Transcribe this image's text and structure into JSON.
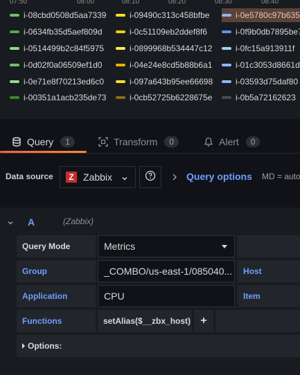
{
  "graph": {
    "time_ticks": [
      "07:50",
      "08:00",
      "08:10",
      "08:20",
      "08:30",
      "08:40"
    ],
    "legend": [
      [
        {
          "label": "i-08cbd0508d5aa7339",
          "color": "#73bf69"
        },
        {
          "label": "i-09490c313c458bfbe",
          "color": "#fade2a"
        },
        {
          "label": "i-0e5780c97b635",
          "color": "#8ab8ff"
        }
      ],
      [
        {
          "label": "i-0634fb35d5aef809d",
          "color": "#56a64b"
        },
        {
          "label": "i-0c51109eb2ddef8f6",
          "color": "#f2cc0c"
        },
        {
          "label": "i-0f9b0db7895be7",
          "color": "#5794f2"
        }
      ],
      [
        {
          "label": "i-0514499b2c84f5975",
          "color": "#96d98d"
        },
        {
          "label": "i-0899968b534447c12",
          "color": "#ffee52"
        },
        {
          "label": "i-0fc15a913911f",
          "color": "#a3d0f0"
        }
      ],
      [
        {
          "label": "i-0d02f0a06509ef1d0",
          "color": "#73bf69"
        },
        {
          "label": "i-04e24e8cd5b88b6a1",
          "color": "#e0b400"
        },
        {
          "label": "i-01c3053d8661d",
          "color": "#8ab8ff"
        }
      ],
      [
        {
          "label": "i-0e71e8f70213ed6c0",
          "color": "#96d98d"
        },
        {
          "label": "i-097a643b95ee66698",
          "color": "#fade2a"
        },
        {
          "label": "i-03593d75daf80",
          "color": "#8ab8ff"
        }
      ],
      [
        {
          "label": "i-00351a1acb235de73",
          "color": "#37872d"
        },
        {
          "label": "i-0cb52725b6228675e",
          "color": "#8a6d1a"
        },
        {
          "label": "i-0b5a72162623",
          "color": "#464c54"
        }
      ]
    ]
  },
  "tabs": [
    {
      "label": "Query",
      "count": "1",
      "icon": "database-icon"
    },
    {
      "label": "Transform",
      "count": "0",
      "icon": "transform-icon"
    },
    {
      "label": "Alert",
      "count": "0",
      "icon": "bell-icon"
    }
  ],
  "datasource_row": {
    "label": "Data source",
    "selected": "Zabbix",
    "logo_letter": "Z",
    "query_options_label": "Query options",
    "query_options_meta": "MD = auto"
  },
  "query": {
    "ref_id": "A",
    "datasource": "(Zabbix)",
    "query_mode_label": "Query Mode",
    "query_mode_value": "Metrics",
    "group_label": "Group",
    "group_value": "_COMBO/us-east-1/085040...",
    "host_label": "Host",
    "application_label": "Application",
    "application_value": "CPU",
    "item_label": "Item",
    "functions_label": "Functions",
    "function_chip": "setAlias($__zbx_host)",
    "add_function": "+",
    "options_label": "Options:"
  }
}
